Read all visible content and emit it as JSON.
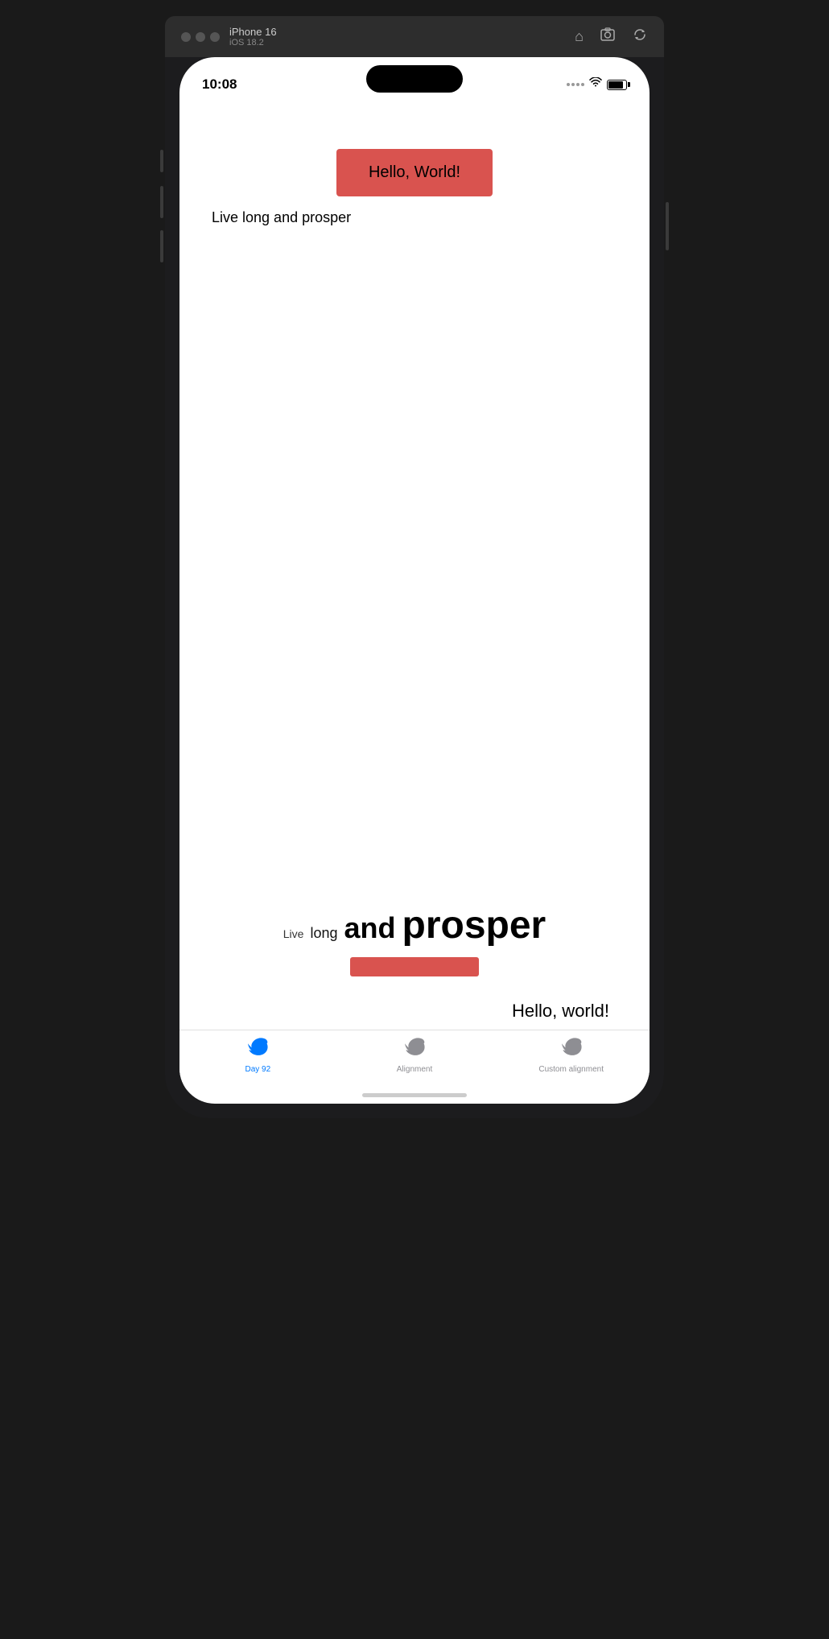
{
  "simulator": {
    "title": "iPhone 16",
    "subtitle": "iOS 18.2",
    "dots": [
      "dot1",
      "dot2",
      "dot3"
    ],
    "icons": {
      "home": "⌂",
      "screenshot": "📷",
      "rotate": "↩"
    }
  },
  "status_bar": {
    "time": "10:08",
    "signal": "...",
    "wifi": "WiFi",
    "battery": "Battery"
  },
  "app": {
    "hello_box_text": "Hello, World!",
    "live_long_text": "Live long and prosper",
    "alignment_words": {
      "live": "Live",
      "long": "long",
      "and": "and",
      "prosper": "prosper"
    },
    "hello_world_bottom": "Hello, world!"
  },
  "tabs": [
    {
      "id": "day92",
      "label": "Day 92",
      "active": true
    },
    {
      "id": "alignment",
      "label": "Alignment",
      "active": false
    },
    {
      "id": "custom-alignment",
      "label": "Custom alignment",
      "active": false
    }
  ],
  "colors": {
    "accent_red": "#d9534f",
    "active_tab": "#007AFF",
    "inactive_tab": "#8e8e93"
  }
}
